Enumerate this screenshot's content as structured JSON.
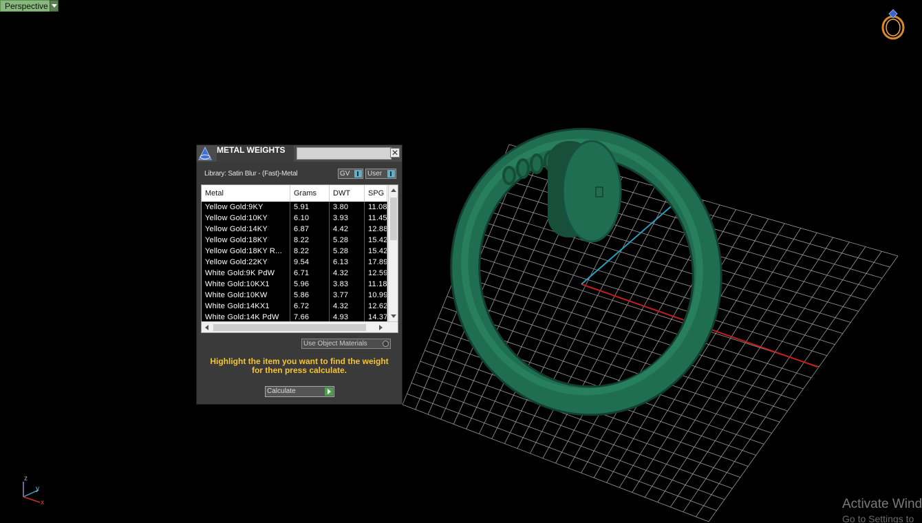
{
  "viewport": {
    "label": "Perspective",
    "axis_labels": {
      "z": "z",
      "y": "y",
      "x": "x"
    },
    "watermark": {
      "line1": "Activate Wind",
      "line2": "Go to Settings to"
    },
    "ring_color": "#1f6e52",
    "grid_color": "#9a9a9a",
    "x_axis_color": "#c41e1e",
    "y_axis_color": "#2a9fc0"
  },
  "dialog": {
    "title": "METAL WEIGHTS",
    "close_label": "✕",
    "library_label": "Library: Satin Blur - (Fast)-Metal",
    "toggle_gv": "GV",
    "toggle_user": "User",
    "columns": [
      "Metal",
      "Grams",
      "DWT",
      "SPG"
    ],
    "rows": [
      [
        "Yellow Gold:9KY",
        "5.91",
        "3.80",
        "11.08"
      ],
      [
        "Yellow Gold:10KY",
        "6.10",
        "3.93",
        "11.45"
      ],
      [
        "Yellow Gold:14KY",
        "6.87",
        "4.42",
        "12.88"
      ],
      [
        "Yellow Gold:18KY",
        "8.22",
        "5.28",
        "15.42"
      ],
      [
        "Yellow Gold:18KY R...",
        "8.22",
        "5.28",
        "15.42"
      ],
      [
        "Yellow Gold:22KY",
        "9.54",
        "6.13",
        "17.89"
      ],
      [
        "White Gold:9K PdW",
        "6.71",
        "4.32",
        "12.59"
      ],
      [
        "White Gold:10KX1",
        "5.96",
        "3.83",
        "11.18"
      ],
      [
        "White Gold:10KW",
        "5.86",
        "3.77",
        "10.99"
      ],
      [
        "White Gold:14KX1",
        "6.72",
        "4.32",
        "12.62"
      ],
      [
        "White Gold:14K PdW",
        "7.66",
        "4.93",
        "14.37"
      ]
    ],
    "use_object_materials": "Use Object Materials",
    "hint": "Highlight the item you want to find the weight for then press calculate.",
    "calculate_label": "Calculate"
  }
}
